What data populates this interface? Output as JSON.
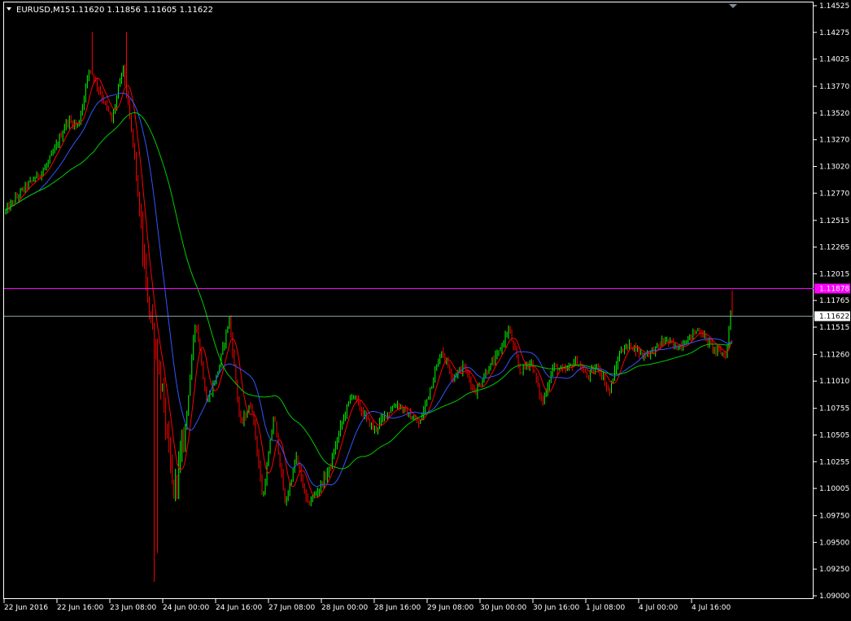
{
  "title": {
    "symbol": "EURUSD,M15",
    "ohlc": "1.11620 1.11856 1.11605 1.11622"
  },
  "colors": {
    "background": "#000000",
    "frame": "#ffffff",
    "up_candle": "#00ff00",
    "down_candle": "#ff0000",
    "ma_fast": "#ff0000",
    "ma_mid": "#3355ff",
    "ma_slow": "#00cc00",
    "hline_magenta": "#ff00ff",
    "hline_bid": "#7f9f9f",
    "label_magenta_bg": "#ff00ff",
    "label_bid_bg": "#ffffff"
  },
  "chart_data": {
    "type": "candlestick",
    "symbol": "EURUSD",
    "timeframe": "M15",
    "ylim": [
      1.09,
      1.14525
    ],
    "y_ticks": [
      "1.14525",
      "1.14275",
      "1.14025",
      "1.13770",
      "1.13520",
      "1.13270",
      "1.13020",
      "1.12770",
      "1.12515",
      "1.12265",
      "1.12015",
      "1.11765",
      "1.11515",
      "1.11260",
      "1.11010",
      "1.10755",
      "1.10505",
      "1.10255",
      "1.10005",
      "1.09750",
      "1.09500",
      "1.09250",
      "1.09000"
    ],
    "x_labels": [
      "22 Jun 2016",
      "22 Jun 16:00",
      "23 Jun 08:00",
      "24 Jun 00:00",
      "24 Jun 16:00",
      "27 Jun 08:00",
      "28 Jun 00:00",
      "28 Jun 16:00",
      "29 Jun 08:00",
      "30 Jun 00:00",
      "30 Jun 16:00",
      "1 Jul 08:00",
      "4 Jul 00:00",
      "4 Jul 16:00"
    ],
    "price_trajectory": [
      [
        0,
        1.126
      ],
      [
        3,
        1.128
      ],
      [
        7,
        1.13
      ],
      [
        9,
        1.132
      ],
      [
        11,
        1.1345
      ],
      [
        13,
        1.134
      ],
      [
        15,
        1.1395
      ],
      [
        17,
        1.137
      ],
      [
        19,
        1.1345
      ],
      [
        21,
        1.1395
      ],
      [
        23,
        1.1315
      ],
      [
        25,
        1.1195
      ],
      [
        26,
        1.116
      ],
      [
        28,
        1.109
      ],
      [
        30,
        1.0995
      ],
      [
        32,
        1.105
      ],
      [
        34,
        1.116
      ],
      [
        36,
        1.108
      ],
      [
        38,
        1.111
      ],
      [
        40,
        1.116
      ],
      [
        42,
        1.106
      ],
      [
        44,
        1.108
      ],
      [
        46,
        1.099
      ],
      [
        48,
        1.107
      ],
      [
        50,
        1.0985
      ],
      [
        52,
        1.103
      ],
      [
        54,
        1.0985
      ],
      [
        56,
        1.1
      ],
      [
        58,
        1.102
      ],
      [
        60,
        1.106
      ],
      [
        62,
        1.109
      ],
      [
        64,
        1.107
      ],
      [
        66,
        1.1055
      ],
      [
        68,
        1.107
      ],
      [
        70,
        1.108
      ],
      [
        72,
        1.107
      ],
      [
        74,
        1.106
      ],
      [
        76,
        1.1095
      ],
      [
        78,
        1.113
      ],
      [
        80,
        1.1105
      ],
      [
        82,
        1.1115
      ],
      [
        84,
        1.109
      ],
      [
        86,
        1.111
      ],
      [
        88,
        1.1125
      ],
      [
        90,
        1.115
      ],
      [
        92,
        1.111
      ],
      [
        94,
        1.112
      ],
      [
        96,
        1.108
      ],
      [
        98,
        1.1115
      ],
      [
        100,
        1.111
      ],
      [
        102,
        1.112
      ],
      [
        104,
        1.1105
      ],
      [
        106,
        1.1115
      ],
      [
        108,
        1.109
      ],
      [
        110,
        1.113
      ],
      [
        112,
        1.1135
      ],
      [
        114,
        1.1125
      ],
      [
        116,
        1.113
      ],
      [
        118,
        1.114
      ],
      [
        120,
        1.1132
      ],
      [
        122,
        1.114
      ],
      [
        124,
        1.115
      ],
      [
        125,
        1.1142
      ],
      [
        127,
        1.113
      ],
      [
        129,
        1.1125
      ],
      [
        130,
        1.1185
      ]
    ],
    "horizontal_lines": [
      {
        "label": "1.11878",
        "value": 1.11878,
        "color": "#ff00ff"
      },
      {
        "label": "1.11622",
        "value": 1.11622,
        "color": "#7f9f9f"
      }
    ]
  }
}
